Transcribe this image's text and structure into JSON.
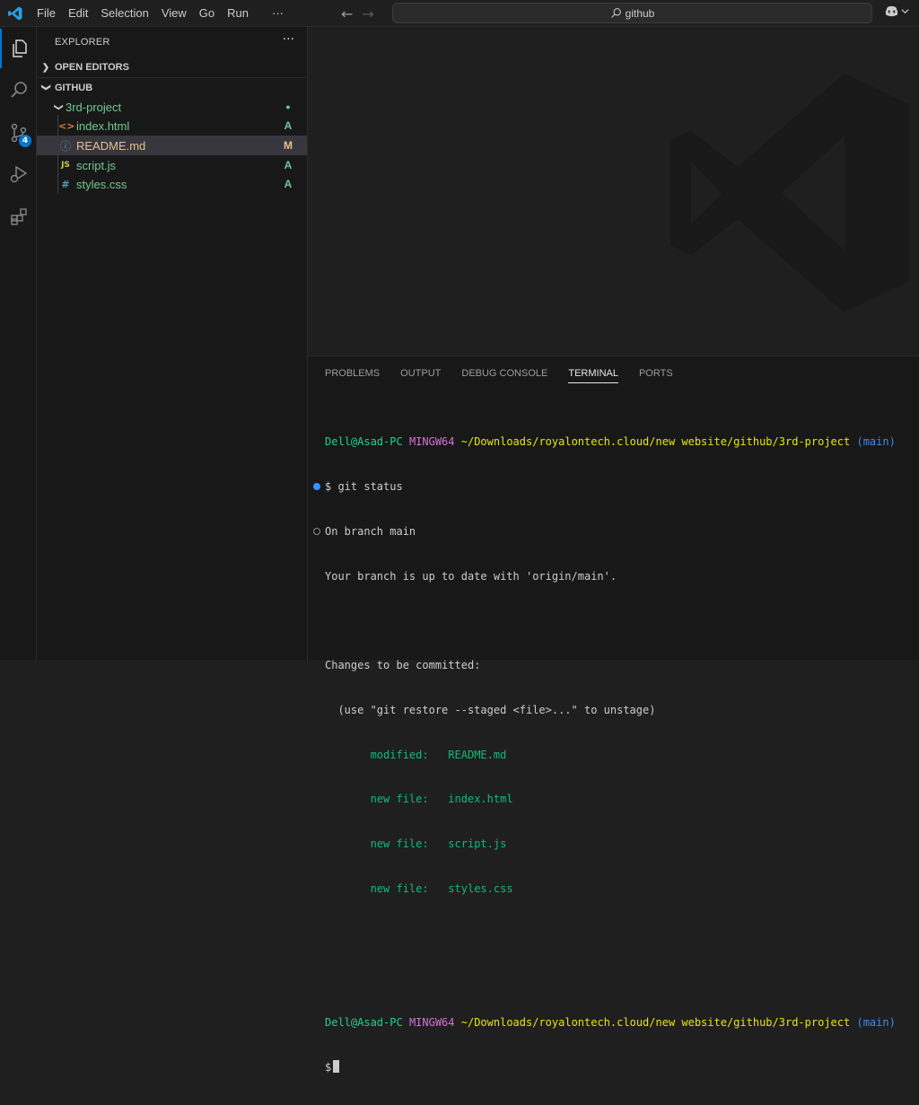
{
  "titlebar": {
    "menu": [
      "File",
      "Edit",
      "Selection",
      "View",
      "Go",
      "Run",
      "···"
    ],
    "search_text": "github",
    "back_icon": "arrow-left-icon",
    "forward_icon": "arrow-right-icon"
  },
  "activitybar": {
    "items": [
      "explorer",
      "search",
      "source-control",
      "run-and-debug",
      "extensions"
    ],
    "scm_badge": "4"
  },
  "sidebar": {
    "title": "EXPLORER",
    "more": "···",
    "open_editors": "OPEN EDITORS",
    "workspace": "GITHUB",
    "folder": "3rd-project",
    "files": [
      {
        "name": "index.html",
        "icon": "<>",
        "status": "A"
      },
      {
        "name": "README.md",
        "icon": "ⓘ",
        "status": "M"
      },
      {
        "name": "script.js",
        "icon": "JS",
        "status": "A"
      },
      {
        "name": "styles.css",
        "icon": "#",
        "status": "A"
      }
    ]
  },
  "panel": {
    "tabs": [
      "PROBLEMS",
      "OUTPUT",
      "DEBUG CONSOLE",
      "TERMINAL",
      "PORTS"
    ],
    "active_tab": "TERMINAL"
  },
  "terminal": {
    "user": "Dell@Asad-PC",
    "shell": "MINGW64",
    "path": "~/Downloads/royalontech.cloud/new website/github/3rd-project",
    "branch": "(main)",
    "cmd": "$ git status",
    "line1": "On branch main",
    "line2": "Your branch is up to date with 'origin/main'.",
    "line3": "Changes to be committed:",
    "line4": "  (use \"git restore --staged <file>...\" to unstage)",
    "changes": [
      {
        "kind": "modified:",
        "file": "README.md"
      },
      {
        "kind": "new file:",
        "file": "index.html"
      },
      {
        "kind": "new file:",
        "file": "script.js"
      },
      {
        "kind": "new file:",
        "file": "styles.css"
      }
    ],
    "prompt": "$"
  },
  "colors": {
    "accent": "#0078d4",
    "added": "#73c991",
    "modified": "#e2c08d"
  }
}
